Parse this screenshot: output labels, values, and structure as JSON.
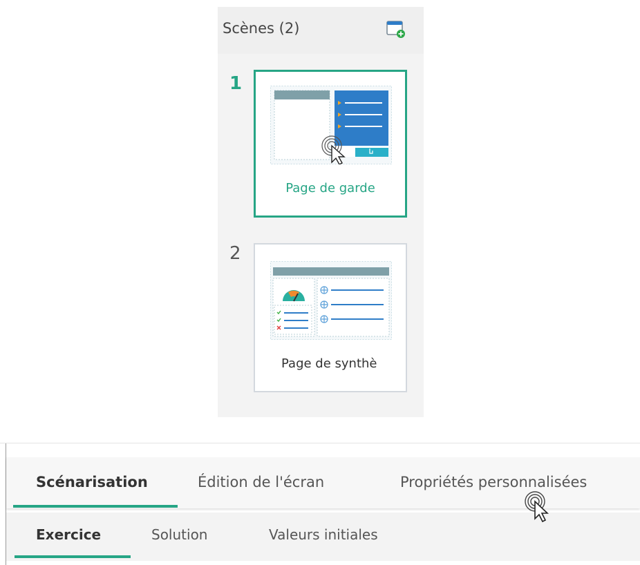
{
  "scenes_panel": {
    "title": "Scènes (2)",
    "add_icon": "add-scene-icon",
    "scenes": [
      {
        "number": "1",
        "label": "Page de garde",
        "selected": true,
        "thumbnail_icon": "cover-page-template-icon"
      },
      {
        "number": "2",
        "label": "Page de synthè",
        "selected": false,
        "thumbnail_icon": "summary-page-template-icon"
      }
    ]
  },
  "main_tabs": {
    "items": [
      {
        "label": "Scénarisation",
        "active": true
      },
      {
        "label": "Édition de l'écran",
        "active": false
      },
      {
        "label": "Propriétés personnalisées",
        "active": false
      }
    ]
  },
  "sub_tabs": {
    "items": [
      {
        "label": "Exercice",
        "active": true
      },
      {
        "label": "Solution",
        "active": false
      },
      {
        "label": "Valeurs initiales",
        "active": false
      }
    ]
  },
  "colors": {
    "accent": "#26a585",
    "thumbnail_blue": "#2e7dc8",
    "thumbnail_header": "#7fa0a8",
    "thumbnail_teal": "#2ab0c8"
  }
}
